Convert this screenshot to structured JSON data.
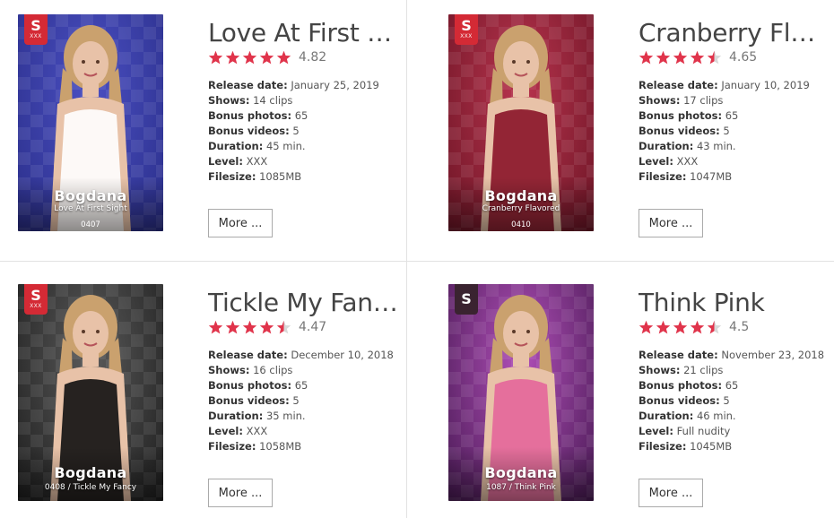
{
  "cards": [
    {
      "title": "Love At First Si...",
      "rating": "4.82",
      "stars": [
        1,
        1,
        1,
        1,
        1
      ],
      "cover": {
        "model": "Bogdana",
        "subtitle": "Love At First Sight",
        "number": "0407",
        "badge_letter": "S",
        "badge_text": "XXX"
      },
      "details": [
        {
          "label": "Release date:",
          "value": "January 25, 2019"
        },
        {
          "label": "Shows:",
          "value": "14 clips"
        },
        {
          "label": "Bonus photos:",
          "value": "65"
        },
        {
          "label": "Bonus videos:",
          "value": "5"
        },
        {
          "label": "Duration:",
          "value": "45 min."
        },
        {
          "label": "Level:",
          "value": "XXX"
        },
        {
          "label": "Filesize:",
          "value": "1085MB"
        }
      ],
      "more_label": "More ...",
      "colors": {
        "bg_top": "#4a4fc2",
        "bg_bottom": "#2b2f8a",
        "accent": "#ffffff"
      }
    },
    {
      "title": "Cranberry Flav...",
      "rating": "4.65",
      "stars": [
        1,
        1,
        1,
        1,
        0.5
      ],
      "cover": {
        "model": "Bogdana",
        "subtitle": "Cranberry Flavored",
        "number": "0410",
        "badge_letter": "S",
        "badge_text": "XXX"
      },
      "details": [
        {
          "label": "Release date:",
          "value": "January 10, 2019"
        },
        {
          "label": "Shows:",
          "value": "17 clips"
        },
        {
          "label": "Bonus photos:",
          "value": "65"
        },
        {
          "label": "Bonus videos:",
          "value": "5"
        },
        {
          "label": "Duration:",
          "value": "43 min."
        },
        {
          "label": "Level:",
          "value": "XXX"
        },
        {
          "label": "Filesize:",
          "value": "1047MB"
        }
      ],
      "more_label": "More ...",
      "colors": {
        "bg_top": "#b8344e",
        "bg_bottom": "#6e1526",
        "accent": "#8a1428"
      }
    },
    {
      "title": "Tickle My Fancy",
      "rating": "4.47",
      "stars": [
        1,
        1,
        1,
        1,
        0.5
      ],
      "cover": {
        "model": "Bogdana",
        "subtitle": "0408 / Tickle My Fancy",
        "number": "",
        "badge_letter": "S",
        "badge_text": "XXX"
      },
      "details": [
        {
          "label": "Release date:",
          "value": "December 10, 2018"
        },
        {
          "label": "Shows:",
          "value": "16 clips"
        },
        {
          "label": "Bonus photos:",
          "value": "65"
        },
        {
          "label": "Bonus videos:",
          "value": "5"
        },
        {
          "label": "Duration:",
          "value": "35 min."
        },
        {
          "label": "Level:",
          "value": "XXX"
        },
        {
          "label": "Filesize:",
          "value": "1058MB"
        }
      ],
      "more_label": "More ...",
      "colors": {
        "bg_top": "#5a5a5a",
        "bg_bottom": "#1e1e1e",
        "accent": "#111111"
      }
    },
    {
      "title": "Think Pink",
      "rating": "4.5",
      "stars": [
        1,
        1,
        1,
        1,
        0.5
      ],
      "cover": {
        "model": "Bogdana",
        "subtitle": "1087 / Think Pink",
        "number": "",
        "badge_letter": "S",
        "badge_text": ""
      },
      "details": [
        {
          "label": "Release date:",
          "value": "November 23, 2018"
        },
        {
          "label": "Shows:",
          "value": "21 clips"
        },
        {
          "label": "Bonus photos:",
          "value": "65"
        },
        {
          "label": "Bonus videos:",
          "value": "5"
        },
        {
          "label": "Duration:",
          "value": "46 min."
        },
        {
          "label": "Level:",
          "value": "Full nudity"
        },
        {
          "label": "Filesize:",
          "value": "1045MB"
        }
      ],
      "more_label": "More ...",
      "colors": {
        "bg_top": "#b04fb8",
        "bg_bottom": "#4a1a55",
        "accent": "#e4669a"
      }
    }
  ],
  "star_color": "#e0344b",
  "star_empty_color": "#d8d8d8"
}
